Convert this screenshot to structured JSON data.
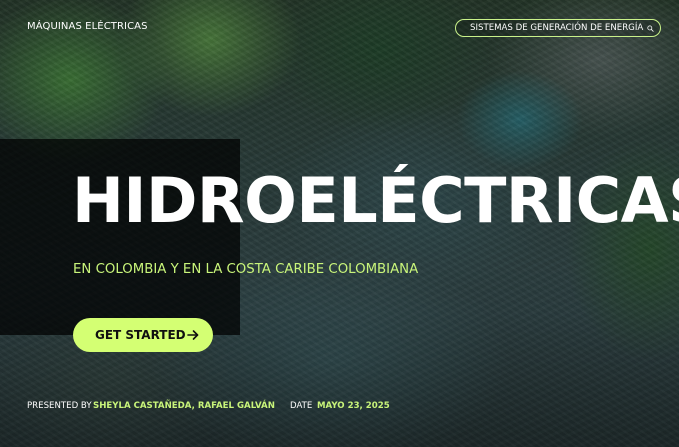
{
  "header": {
    "course_name": "MÁQUINAS ELÉCTRICAS",
    "nav_pill": {
      "label": "SISTEMAS DE GENERACIÓN DE ENERGÍA",
      "icon": "search-icon"
    }
  },
  "hero": {
    "title": "HIDROELÉCTRICAS",
    "subtitle": "EN COLOMBIA Y EN LA COSTA CARIBE COLOMBIANA",
    "cta": {
      "label": "GET STARTED",
      "icon": "arrow-right-icon"
    }
  },
  "footer": {
    "presented_label": "PRESENTED BY",
    "presenters": "SHEYLA CASTAÑEDA, RAFAEL GALVÁN",
    "date_label": "DATE",
    "date_value": "MAYO 23, 2025"
  },
  "colors": {
    "accent": "#d4ff73",
    "accent_text": "#c9f57a",
    "overlay": "#000000"
  }
}
